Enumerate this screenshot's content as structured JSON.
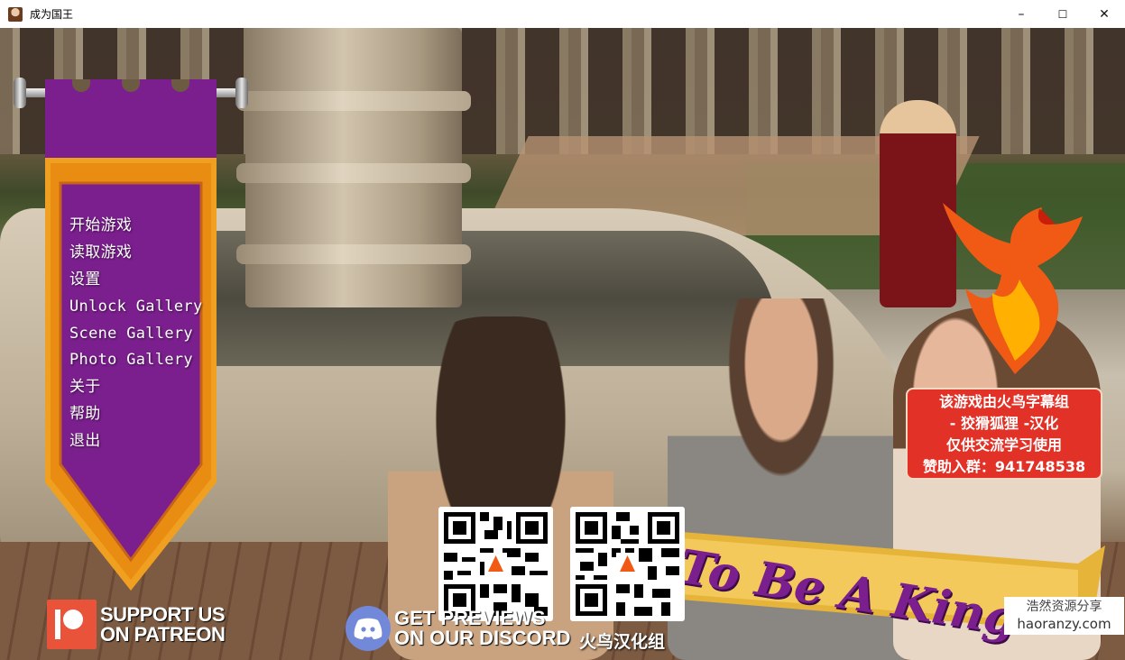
{
  "window": {
    "title": "成为国王",
    "controls": {
      "minimize": "–",
      "maximize": "☐",
      "close": "✕"
    }
  },
  "menu": {
    "items": [
      "开始游戏",
      "读取游戏",
      "设置",
      "Unlock Gallery",
      "Scene Gallery",
      "Photo Gallery",
      "关于",
      "帮助",
      "退出"
    ]
  },
  "patreon": {
    "line1": "SUPPORT US",
    "line2": "ON PATREON"
  },
  "discord": {
    "line1": "GET PREVIEWS",
    "line2": "ON OUR DISCORD"
  },
  "qr_captions": {
    "right": "火鸟汉化组"
  },
  "notice": {
    "lines": [
      "该游戏由火鸟字幕组",
      "- 狡猾狐狸 -汉化",
      "仅供交流学习使用",
      "赞助入群：941748538"
    ]
  },
  "game_title": "To Be A King",
  "watermark": {
    "line1": "浩然资源分享",
    "line2": "haoranzy.com"
  },
  "colors": {
    "banner_purple": "#7b1f8e",
    "banner_gold": "#f0a020",
    "notice_red": "#e23227",
    "patreon_orange": "#e8533a",
    "discord_blurple": "#7289da"
  },
  "icons": {
    "app": "king-portrait-icon",
    "patreon": "patreon-icon",
    "discord": "discord-icon",
    "phoenix": "phoenix-emblem-icon"
  }
}
